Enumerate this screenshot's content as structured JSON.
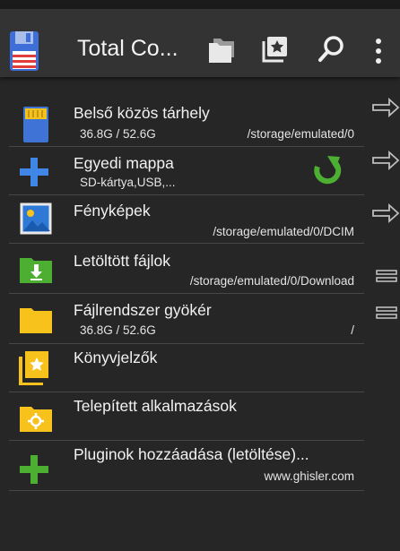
{
  "app": {
    "title": "Total Co...",
    "toolbar_icons": [
      "floppy-disk-icon",
      "folders-icon",
      "bookmark-star-icon",
      "search-icon",
      "more-vert-icon"
    ]
  },
  "colors": {
    "background": "#262626",
    "appbar": "#333333",
    "folder_yellow": "#f7c21c",
    "green": "#4caf32",
    "blue": "#3f86e6"
  },
  "items": [
    {
      "name": "Belső közös tárhely",
      "info": "36.8G / 52.6G",
      "path": "/storage/emulated/0",
      "icon": "sd-card-icon",
      "side": "arrow-right-icon"
    },
    {
      "name": "Egyedi mappa",
      "info": "SD-kártya,USB,...",
      "path": "",
      "icon": "plus-blue-icon",
      "side": "arrow-right-icon",
      "extra": "refresh-icon"
    },
    {
      "name": "Fényképek",
      "info": "",
      "path": "/storage/emulated/0/DCIM",
      "icon": "photo-icon",
      "side": "arrow-right-icon"
    },
    {
      "name": "Letöltött fájlok",
      "info": "",
      "path": "/storage/emulated/0/Download",
      "icon": "download-folder-icon",
      "side": "equals-icon"
    },
    {
      "name": "Fájlrendszer gyökér",
      "info": "36.8G / 52.6G",
      "path": "/",
      "icon": "folder-icon",
      "side": "equals-icon"
    },
    {
      "name": "Könyvjelzők",
      "info": "",
      "path": "",
      "icon": "bookmarks-icon"
    },
    {
      "name": "Telepített alkalmazások",
      "info": "",
      "path": "",
      "icon": "apps-folder-icon"
    },
    {
      "name": "Pluginok hozzáadása (letöltése)...",
      "info": "",
      "path": "www.ghisler.com",
      "icon": "plus-green-icon"
    }
  ]
}
